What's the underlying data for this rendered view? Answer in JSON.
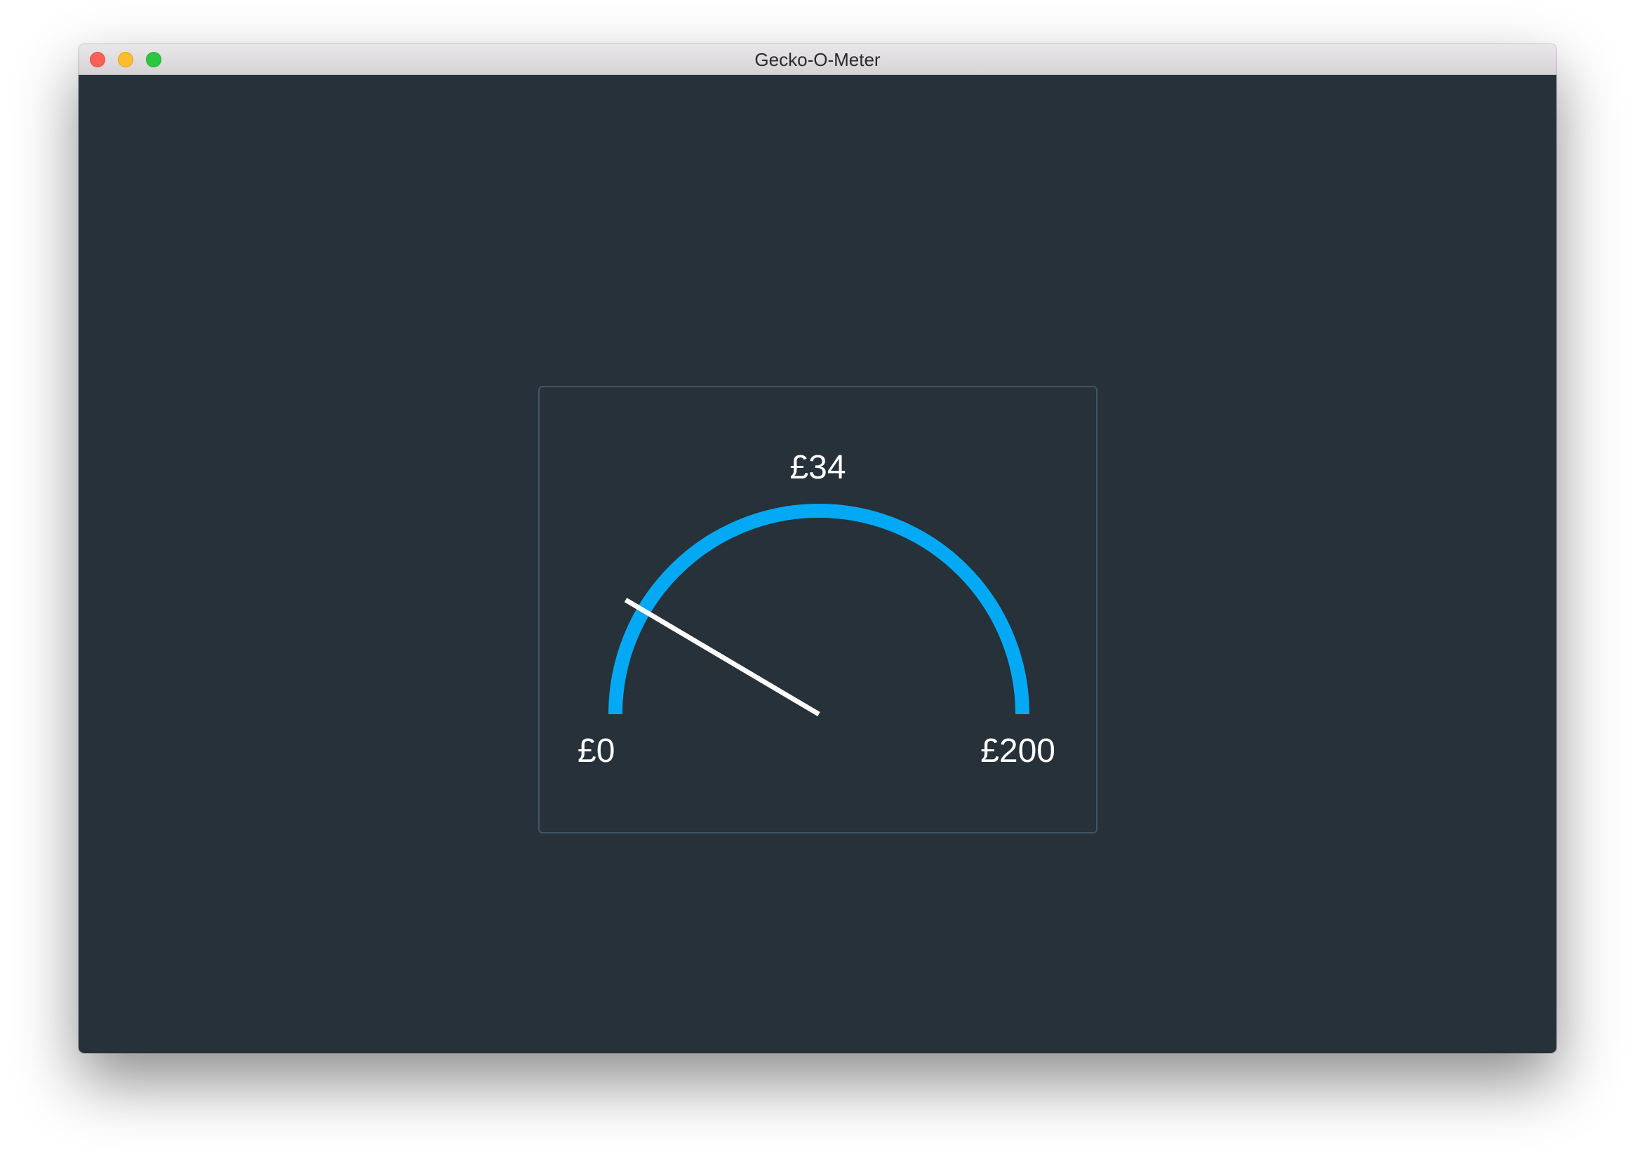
{
  "window": {
    "title": "Gecko-O-Meter",
    "controls": {
      "close": "close-button",
      "minimize": "minimize-button",
      "zoom": "zoom-button"
    }
  },
  "gauge": {
    "value_label": "£34",
    "min_label": "£0",
    "max_label": "£200",
    "value": 34,
    "min": 0,
    "max": 200,
    "arc_color": "#03a9f4",
    "needle_color": "#ffffff",
    "background_color": "#263139",
    "border_color": "#3e5566"
  }
}
